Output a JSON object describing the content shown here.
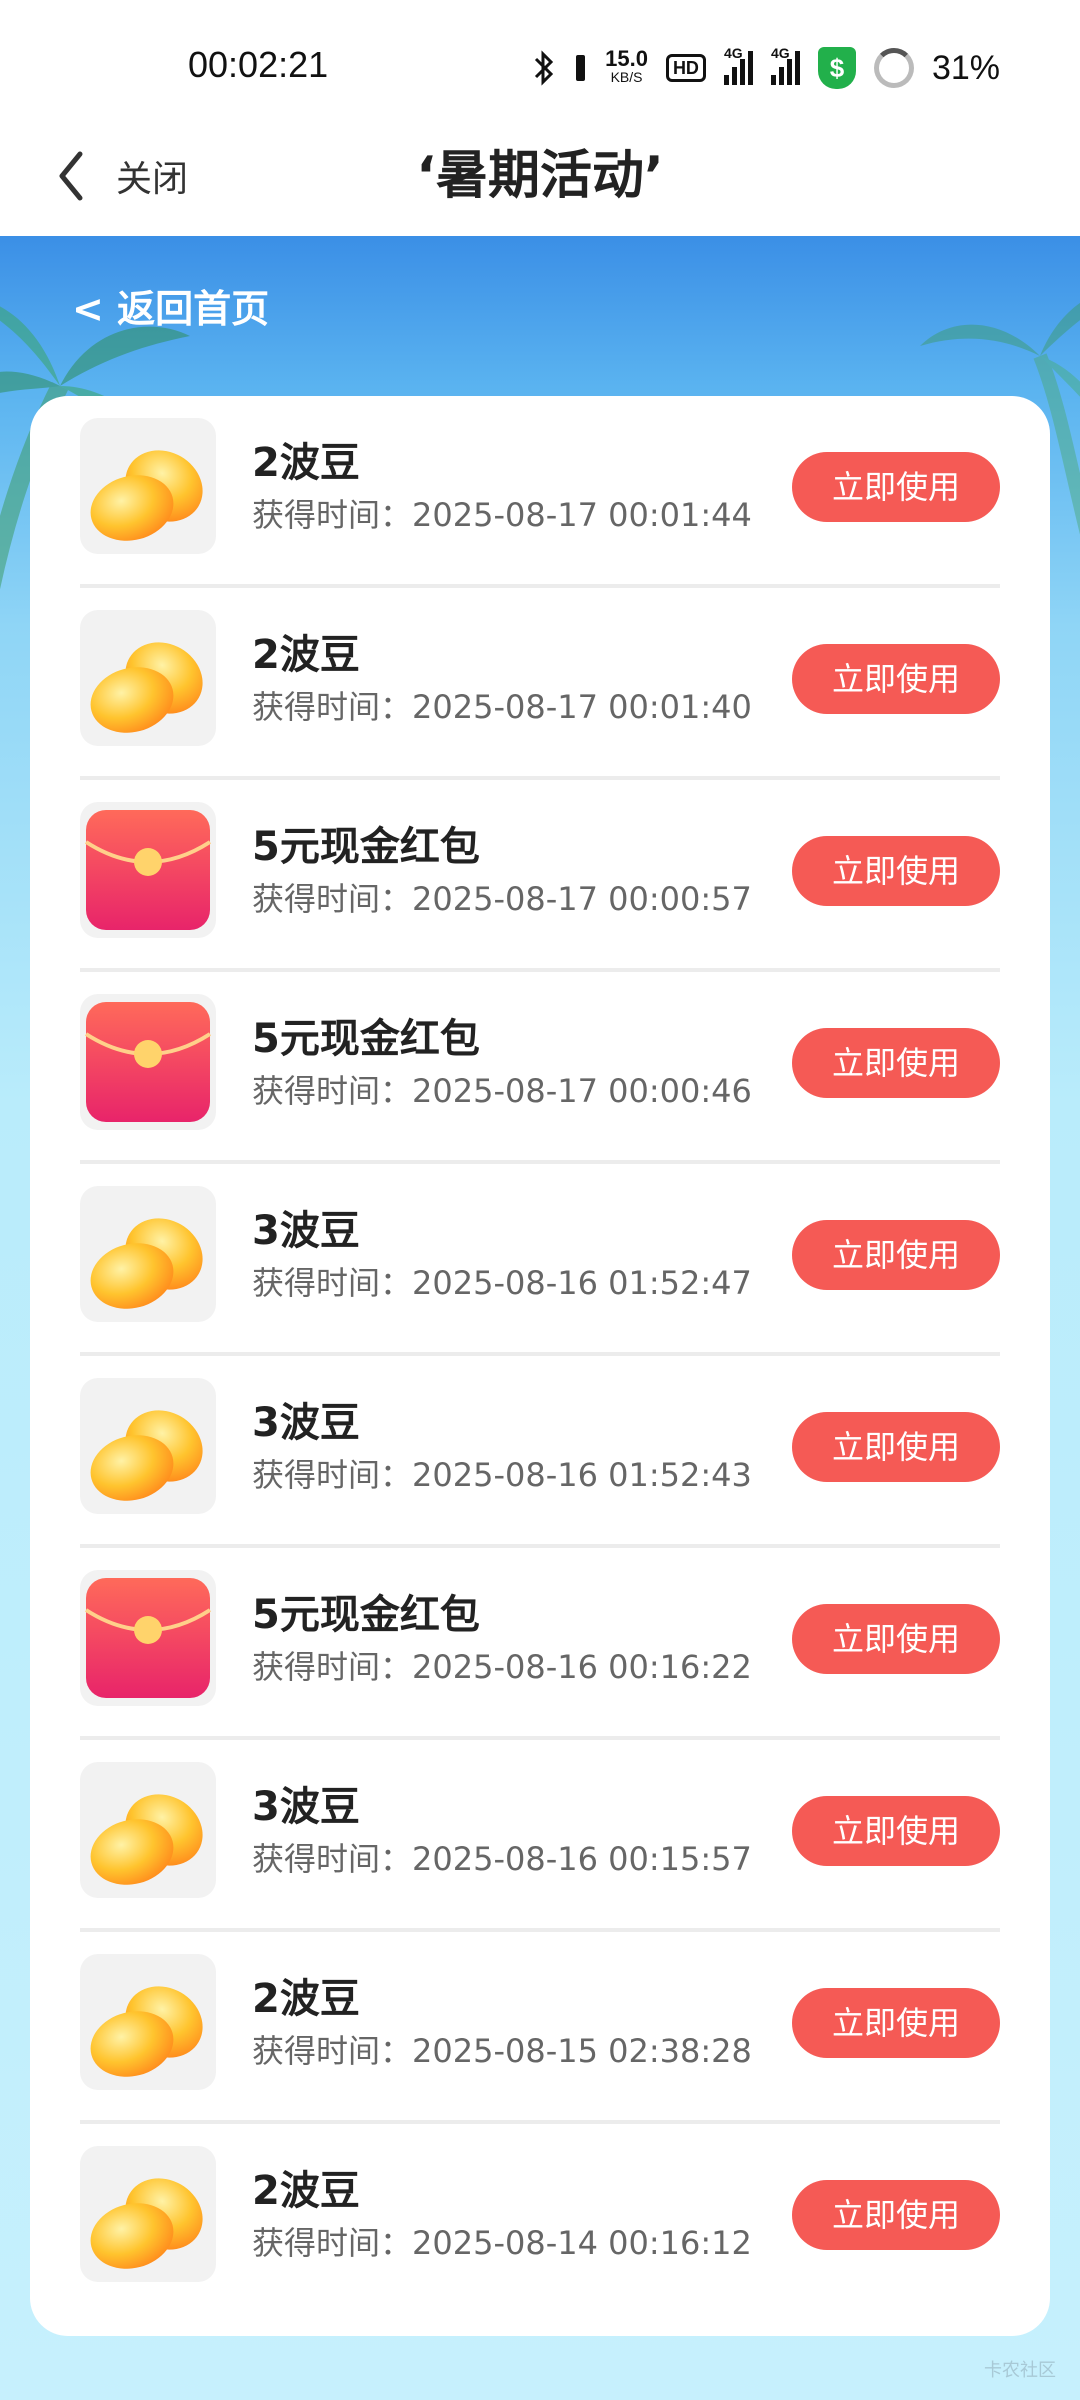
{
  "status_bar": {
    "time": "00:02:21",
    "net_speed_value": "15.0",
    "net_speed_unit": "KB/S",
    "hd": "HD",
    "signal_1": "4G",
    "signal_2": "4G",
    "shield_symbol": "$",
    "battery": "31%"
  },
  "nav": {
    "close_label": "关闭",
    "title": "‘暑期活动’"
  },
  "page": {
    "back_home": "< 返回首页",
    "watermark": "卡农社区"
  },
  "items": [
    {
      "icon": "beans-icon",
      "title": "2波豆",
      "time": "获得时间：2025-08-17 00:01:44",
      "button": "立即使用"
    },
    {
      "icon": "beans-icon",
      "title": "2波豆",
      "time": "获得时间：2025-08-17 00:01:40",
      "button": "立即使用"
    },
    {
      "icon": "red-envelope-icon",
      "title": "5元现金红包",
      "time": "获得时间：2025-08-17 00:00:57",
      "button": "立即使用"
    },
    {
      "icon": "red-envelope-icon",
      "title": "5元现金红包",
      "time": "获得时间：2025-08-17 00:00:46",
      "button": "立即使用"
    },
    {
      "icon": "beans-icon",
      "title": "3波豆",
      "time": "获得时间：2025-08-16 01:52:47",
      "button": "立即使用"
    },
    {
      "icon": "beans-icon",
      "title": "3波豆",
      "time": "获得时间：2025-08-16 01:52:43",
      "button": "立即使用"
    },
    {
      "icon": "red-envelope-icon",
      "title": "5元现金红包",
      "time": "获得时间：2025-08-16 00:16:22",
      "button": "立即使用"
    },
    {
      "icon": "beans-icon",
      "title": "3波豆",
      "time": "获得时间：2025-08-16 00:15:57",
      "button": "立即使用"
    },
    {
      "icon": "beans-icon",
      "title": "2波豆",
      "time": "获得时间：2025-08-15 02:38:28",
      "button": "立即使用"
    },
    {
      "icon": "beans-icon",
      "title": "2波豆",
      "time": "获得时间：2025-08-14 00:16:12",
      "button": "立即使用"
    }
  ],
  "colors": {
    "accent_button": "#f55a55",
    "shield_green": "#22b04b",
    "sky_top": "#3b8fe6",
    "sky_bottom": "#c6f0fd"
  }
}
